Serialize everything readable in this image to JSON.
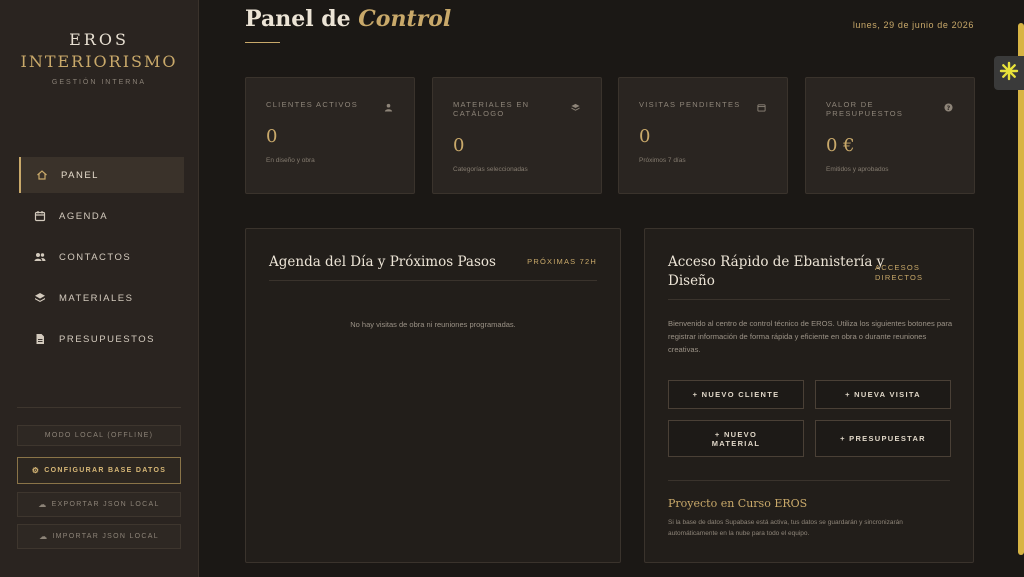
{
  "brand": {
    "name": "EROS",
    "subtitle": "INTERIORISMO",
    "tagline": "GESTIÓN INTERNA"
  },
  "nav": {
    "items": [
      {
        "label": "PANEL",
        "icon": "home-icon"
      },
      {
        "label": "AGENDA",
        "icon": "calendar-icon"
      },
      {
        "label": "CONTACTOS",
        "icon": "people-icon"
      },
      {
        "label": "MATERIALES",
        "icon": "layers-icon"
      },
      {
        "label": "PRESUPUESTOS",
        "icon": "document-icon"
      }
    ]
  },
  "sidebar_actions": {
    "mode": "MODO LOCAL (OFFLINE)",
    "configure": "CONFIGURAR BASE DATOS",
    "export": "EXPORTAR JSON LOCAL",
    "import": "IMPORTAR JSON LOCAL"
  },
  "header": {
    "title_main": "Panel de",
    "title_accent": "Control",
    "date": "lunes, 29 de junio de 2026"
  },
  "stats": [
    {
      "label": "CLIENTES ACTIVOS",
      "value": "0",
      "desc": "En diseño y obra",
      "icon": "user-icon"
    },
    {
      "label": "MATERIALES EN CATÁLOGO",
      "value": "0",
      "desc": "Categorías seleccionadas",
      "icon": "layers-icon"
    },
    {
      "label": "VISITAS PENDIENTES",
      "value": "0",
      "desc": "Próximos 7 días",
      "icon": "calendar-icon"
    },
    {
      "label": "VALOR DE PRESUPUESTOS",
      "value": "0 €",
      "desc": "Emitidos y aprobados",
      "icon": "help-icon"
    }
  ],
  "agenda": {
    "title": "Agenda del Día y Próximos Pasos",
    "tag": "PRÓXIMAS 72H",
    "empty": "No hay visitas de obra ni reuniones programadas."
  },
  "quick_access": {
    "title_line1": "Acceso Rápido de Ebanistería y",
    "title_line2": "Diseño",
    "tag_line1": "ACCESOS",
    "tag_line2": "DIRECTOS",
    "intro": "Bienvenido al centro de control técnico de EROS. Utiliza los siguientes botones para registrar información de forma rápida y eficiente en obra o durante reuniones creativas.",
    "buttons": {
      "new_client": "+ NUEVO CLIENTE",
      "new_visit": "+ NUEVA VISITA",
      "new_material_1": "+ NUEVO",
      "new_material_2": "MATERIAL",
      "quote": "+ PRESUPUESTAR"
    },
    "project_title": "Proyecto en Curso EROS",
    "project_text": "Si la base de datos Supabase está activa, tus datos se guardarán y sincronizarán automáticamente en la nube para todo el equipo."
  },
  "colors": {
    "accent": "#c9a96a",
    "background": "#1b1815",
    "sidebar": "#2a2420",
    "scrollbar": "#d8b444"
  }
}
